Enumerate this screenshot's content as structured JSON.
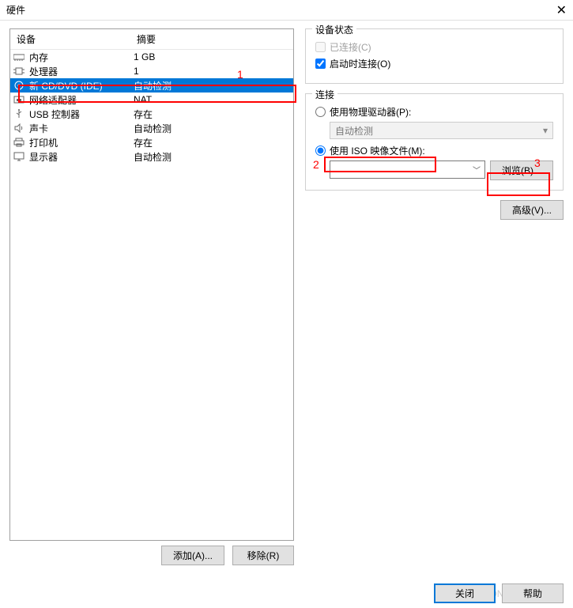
{
  "title": "硬件",
  "list": {
    "header_device": "设备",
    "header_summary": "摘要",
    "rows": [
      {
        "icon": "memory-icon",
        "name": "内存",
        "summary": "1 GB"
      },
      {
        "icon": "cpu-icon",
        "name": "处理器",
        "summary": "1"
      },
      {
        "icon": "disc-icon",
        "name": "新 CD/DVD (IDE)",
        "summary": "自动检测",
        "selected": true
      },
      {
        "icon": "nic-icon",
        "name": "网络适配器",
        "summary": "NAT"
      },
      {
        "icon": "usb-icon",
        "name": "USB 控制器",
        "summary": "存在"
      },
      {
        "icon": "sound-icon",
        "name": "声卡",
        "summary": "自动检测"
      },
      {
        "icon": "printer-icon",
        "name": "打印机",
        "summary": "存在"
      },
      {
        "icon": "display-icon",
        "name": "显示器",
        "summary": "自动检测"
      }
    ]
  },
  "buttons": {
    "add": "添加(A)...",
    "remove": "移除(R)",
    "browse": "浏览(B)...",
    "advanced": "高级(V)...",
    "close": "关闭",
    "help": "帮助"
  },
  "status": {
    "title": "设备状态",
    "connected": "已连接(C)",
    "connect_on_power": "启动时连接(O)"
  },
  "connection": {
    "title": "连接",
    "physical": "使用物理驱动器(P):",
    "physical_value": "自动检测",
    "iso": "使用 ISO 映像文件(M):",
    "iso_value": ""
  },
  "annotations": {
    "n1": "1",
    "n2": "2",
    "n3": "3"
  },
  "watermark": "CSDN @筒陆"
}
